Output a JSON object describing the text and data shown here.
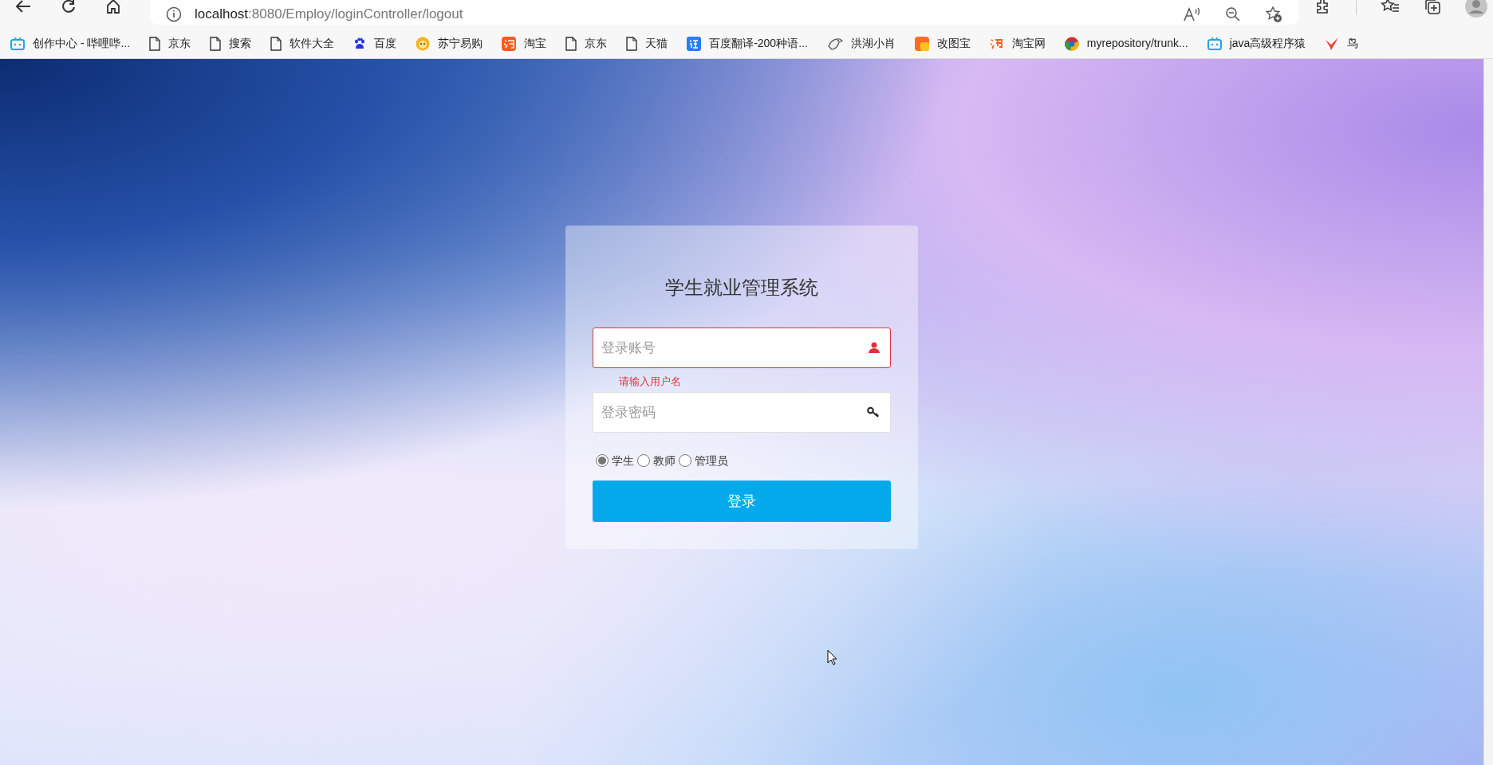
{
  "browser": {
    "address": {
      "host": "localhost",
      "rest": ":8080/Employ/loginController/logout"
    }
  },
  "bookmarks": [
    {
      "label": "创作中心 - 哔哩哔...",
      "kind": "tv"
    },
    {
      "label": "京东",
      "kind": "page"
    },
    {
      "label": "搜索",
      "kind": "page"
    },
    {
      "label": "软件大全",
      "kind": "page"
    },
    {
      "label": "百度",
      "kind": "paw"
    },
    {
      "label": "苏宁易购",
      "kind": "lion"
    },
    {
      "label": "淘宝",
      "kind": "tao"
    },
    {
      "label": "京东",
      "kind": "page"
    },
    {
      "label": "天猫",
      "kind": "page"
    },
    {
      "label": "百度翻译-200种语...",
      "kind": "yi"
    },
    {
      "label": "洪湖小肖",
      "kind": "bird"
    },
    {
      "label": "改图宝",
      "kind": "square"
    },
    {
      "label": "淘宝网",
      "kind": "taoplain"
    },
    {
      "label": "myrepository/trunk...",
      "kind": "globe"
    },
    {
      "label": "java高级程序猿",
      "kind": "tv"
    },
    {
      "label": "鸟",
      "kind": "fork"
    }
  ],
  "login": {
    "title": "学生就业管理系统",
    "username": {
      "placeholder": "登录账号",
      "invalid": true,
      "error": "请输入用户名"
    },
    "password": {
      "placeholder": "登录密码"
    },
    "roles": [
      {
        "label": "学生",
        "selected": true
      },
      {
        "label": "教师",
        "selected": false
      },
      {
        "label": "管理员",
        "selected": false
      }
    ],
    "submit": "登录"
  }
}
